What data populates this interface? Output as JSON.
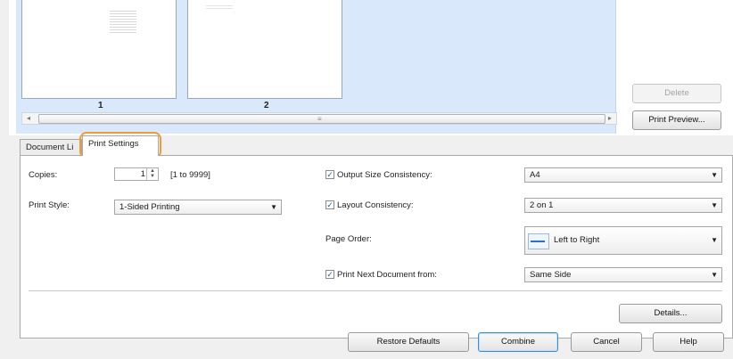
{
  "preview": {
    "pages": [
      {
        "number": "1"
      },
      {
        "number": "2"
      }
    ],
    "delete_label": "Delete",
    "print_preview_label": "Print Preview...",
    "scroll_left_glyph": "◂",
    "scroll_right_glyph": "▸",
    "scroll_grip_glyph": "≡"
  },
  "tabs": [
    {
      "label": "Document Li",
      "active": false
    },
    {
      "label": "Print Settings",
      "active": true
    }
  ],
  "settings": {
    "copies_label": "Copies:",
    "copies_value": "1",
    "copies_range": "[1 to 9999]",
    "print_style_label": "Print Style:",
    "print_style_value": "1-Sided Printing",
    "output_size": {
      "label": "Output Size Consistency:",
      "checked": true,
      "value": "A4"
    },
    "layout": {
      "label": "Layout Consistency:",
      "checked": true,
      "value": "2 on 1"
    },
    "page_order": {
      "label": "Page Order:",
      "value": "Left to Right"
    },
    "print_next": {
      "label": "Print Next Document from:",
      "checked": true,
      "value": "Same Side"
    },
    "details_label": "Details..."
  },
  "footer": {
    "restore_label": "Restore Defaults",
    "combine_label": "Combine",
    "cancel_label": "Cancel",
    "help_label": "Help"
  },
  "icons": {
    "check": "✓",
    "dropdown": "▼",
    "spin_up": "▲",
    "spin_down": "▼"
  },
  "colors": {
    "preview_bg": "#d9e8fb",
    "highlight": "#f29b35",
    "default_button": "#3c8bd6"
  }
}
